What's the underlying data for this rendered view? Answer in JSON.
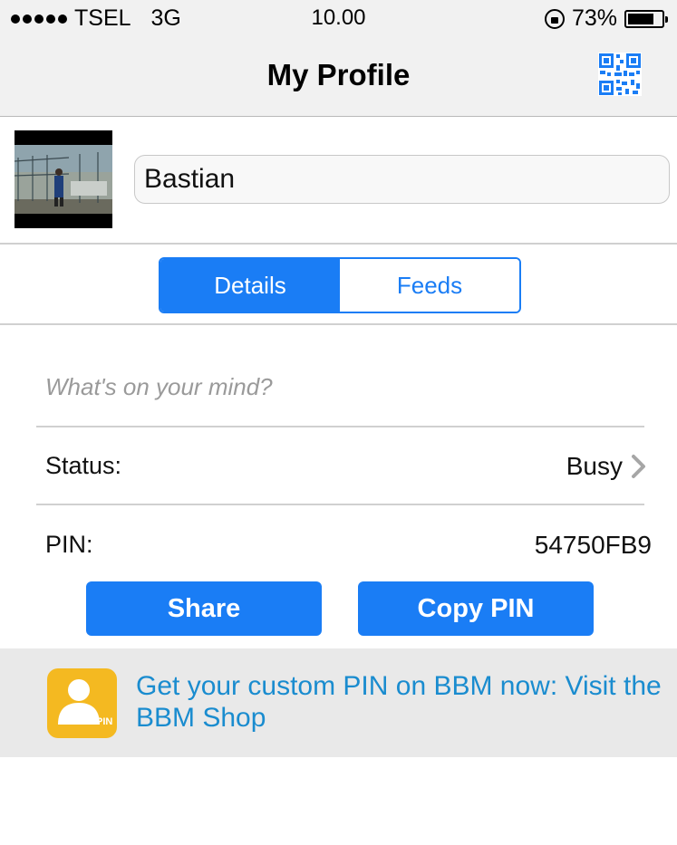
{
  "status_bar": {
    "carrier": "TSEL",
    "network": "3G",
    "time": "10.00",
    "battery": "73%",
    "battery_level": 0.73
  },
  "nav": {
    "title": "My Profile",
    "qr_icon": "qr-code-icon"
  },
  "profile": {
    "display_name": "Bastian"
  },
  "tabs": [
    {
      "label": "Details",
      "active": true
    },
    {
      "label": "Feeds",
      "active": false
    }
  ],
  "details": {
    "mind_placeholder": "What's on your mind?",
    "status_label": "Status:",
    "status_value": "Busy",
    "pin_label": "PIN:",
    "pin_value": "54750FB9"
  },
  "buttons": {
    "share": "Share",
    "copy_pin": "Copy PIN"
  },
  "promo": {
    "text": "Get your custom PIN on BBM now: Visit the BBM Shop",
    "icon_label": "PIN"
  },
  "colors": {
    "accent": "#1a7df5",
    "promo_text": "#1a8ccf",
    "promo_icon": "#f4b921"
  }
}
